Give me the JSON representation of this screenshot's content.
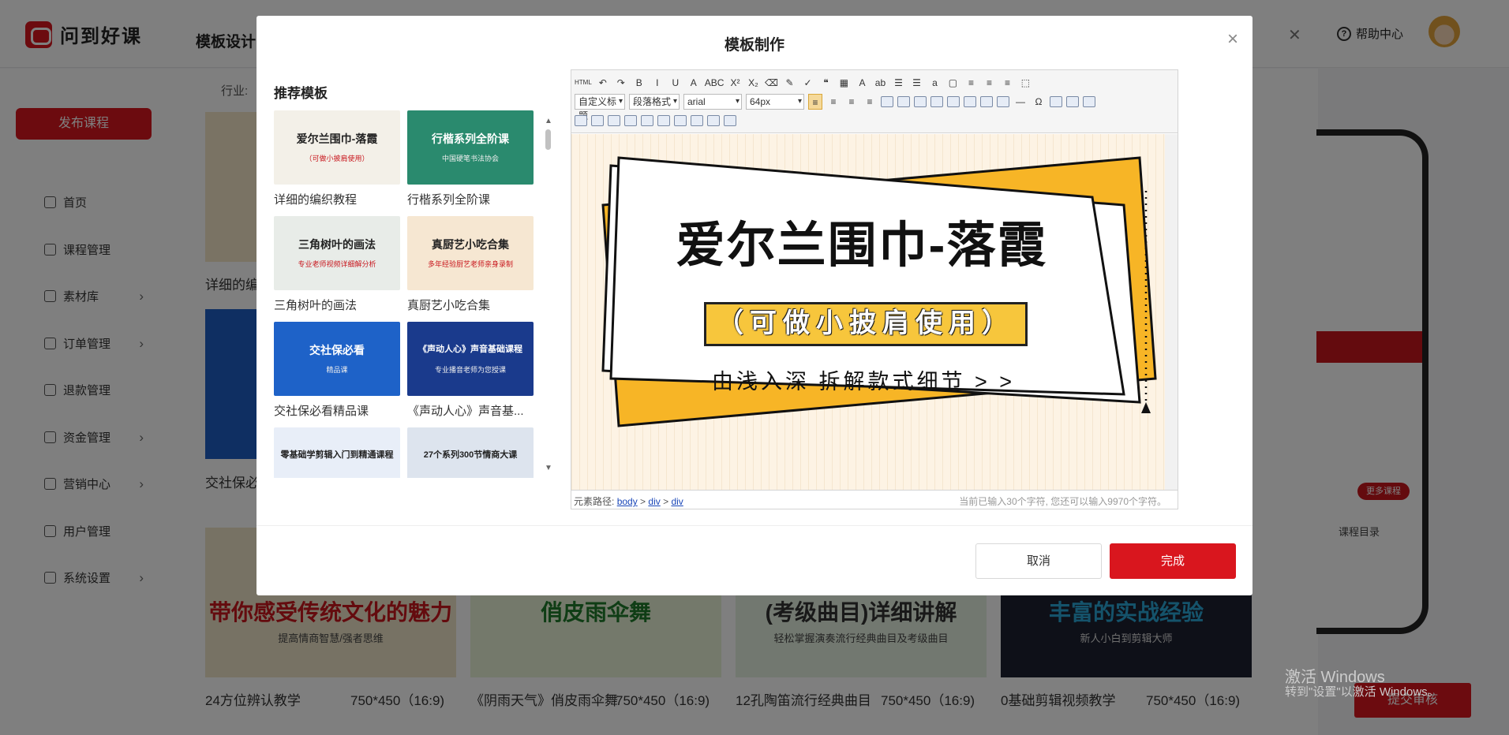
{
  "app": {
    "logo_text": "问到好课",
    "page_title": "模板设计",
    "help_label": "帮助中心",
    "close_glyph": "✕"
  },
  "sidebar": {
    "publish_label": "发布课程",
    "items": [
      {
        "label": "首页",
        "icon": "home-icon",
        "has_children": false
      },
      {
        "label": "课程管理",
        "icon": "chat-icon",
        "has_children": false
      },
      {
        "label": "素材库",
        "icon": "folder-icon",
        "has_children": true
      },
      {
        "label": "订单管理",
        "icon": "monitor-icon",
        "has_children": true
      },
      {
        "label": "退款管理",
        "icon": "refund-icon",
        "has_children": false
      },
      {
        "label": "资金管理",
        "icon": "wallet-icon",
        "has_children": true
      },
      {
        "label": "营销中心",
        "icon": "gift-icon",
        "has_children": true
      },
      {
        "label": "用户管理",
        "icon": "user-icon",
        "has_children": false
      },
      {
        "label": "系统设置",
        "icon": "gear-icon",
        "has_children": true
      }
    ]
  },
  "background": {
    "industry_label": "行业:",
    "left_cards": [
      {
        "title": "详细的编"
      },
      {
        "title": "交社保必"
      }
    ],
    "bottom_cards": [
      {
        "title": "24方位辨认教学",
        "size": "750*450（16:9)",
        "text": "带你感受传统文化的魅力",
        "sub": "提高情商智慧/强者思维"
      },
      {
        "title": "《阴雨天气》俏皮雨伞舞",
        "size": "750*450（16:9)",
        "text": "俏皮雨伞舞"
      },
      {
        "title": "12孔陶笛流行经典曲目",
        "size": "750*450（16:9)",
        "text": "(考级曲目)详细讲解",
        "sub": "轻松掌握演奏流行经典曲目及考级曲目"
      },
      {
        "title": "0基础剪辑视频教学",
        "size": "750*450（16:9)",
        "text": "丰富的实战经验",
        "sub": "新人小白到剪辑大师"
      }
    ],
    "more_courses": "更多课程",
    "course_directory": "课程目录",
    "submit_label": "提交审核",
    "windows_line1": "激活 Windows",
    "windows_line2": "转到\"设置\"以激活 Windows。"
  },
  "modal": {
    "title": "模板制作",
    "close_glyph": "×",
    "recommended_title": "推荐模板",
    "templates": [
      {
        "label": "详细的编织教程",
        "bg": "#f3f0e8",
        "title": "爱尔兰围巾-落霞",
        "sub": "（可做小披肩使用）"
      },
      {
        "label": "行楷系列全阶课",
        "bg": "#2a8a6e",
        "title": "行楷系列全阶课",
        "sub": "中国硬笔书法协会"
      },
      {
        "label": "三角树叶的画法",
        "bg": "#e8ece8",
        "title": "三角树叶的画法",
        "sub": "专业老师视频详细解分析"
      },
      {
        "label": "真厨艺小吃合集",
        "bg": "#f6e7d2",
        "title": "真厨艺小吃合集",
        "sub": "多年经验厨艺老师亲身录制"
      },
      {
        "label": "交社保必看精品课",
        "bg": "#1e62c8",
        "title": "交社保必看",
        "sub": "精品课"
      },
      {
        "label": "《声动人心》声音基...",
        "bg": "#1a3a8c",
        "title": "《声动人心》声音基础课程",
        "sub": "专业播音老师为您授课"
      },
      {
        "label": "零基础学剪辑入门到精通课程",
        "bg": "#e8eef8",
        "title": "零基础学剪辑入门到精通课程",
        "sub": ""
      },
      {
        "label": "27个系列300节情商大课",
        "bg": "#dde4ee",
        "title": "27个系列300节情商大课",
        "sub": ""
      }
    ],
    "toolbar": {
      "row1": [
        "HTML",
        "↶",
        "↷",
        "B",
        "I",
        "U",
        "A",
        "ABC",
        "X²",
        "X₂",
        "⌫",
        "✎",
        "✓",
        "❝",
        "▦",
        "A",
        "ab",
        "☰",
        "☰",
        "a",
        "▢",
        "≡",
        "≡",
        "≡",
        "⬚"
      ],
      "font_format": "自定义标题",
      "paragraph_format": "段落格式",
      "font_family": "arial",
      "font_size": "64px"
    },
    "canvas": {
      "headline": "爱尔兰围巾-落霞",
      "subtitle": "（可做小披肩使用）",
      "tagline": "由浅入深  拆解款式细节 > >"
    },
    "status": {
      "path_label": "元素路径:",
      "path": [
        "body",
        "div",
        "div"
      ],
      "count_text": "当前已输入30个字符, 您还可以输入9970个字符。"
    },
    "cancel_label": "取消",
    "done_label": "完成"
  }
}
